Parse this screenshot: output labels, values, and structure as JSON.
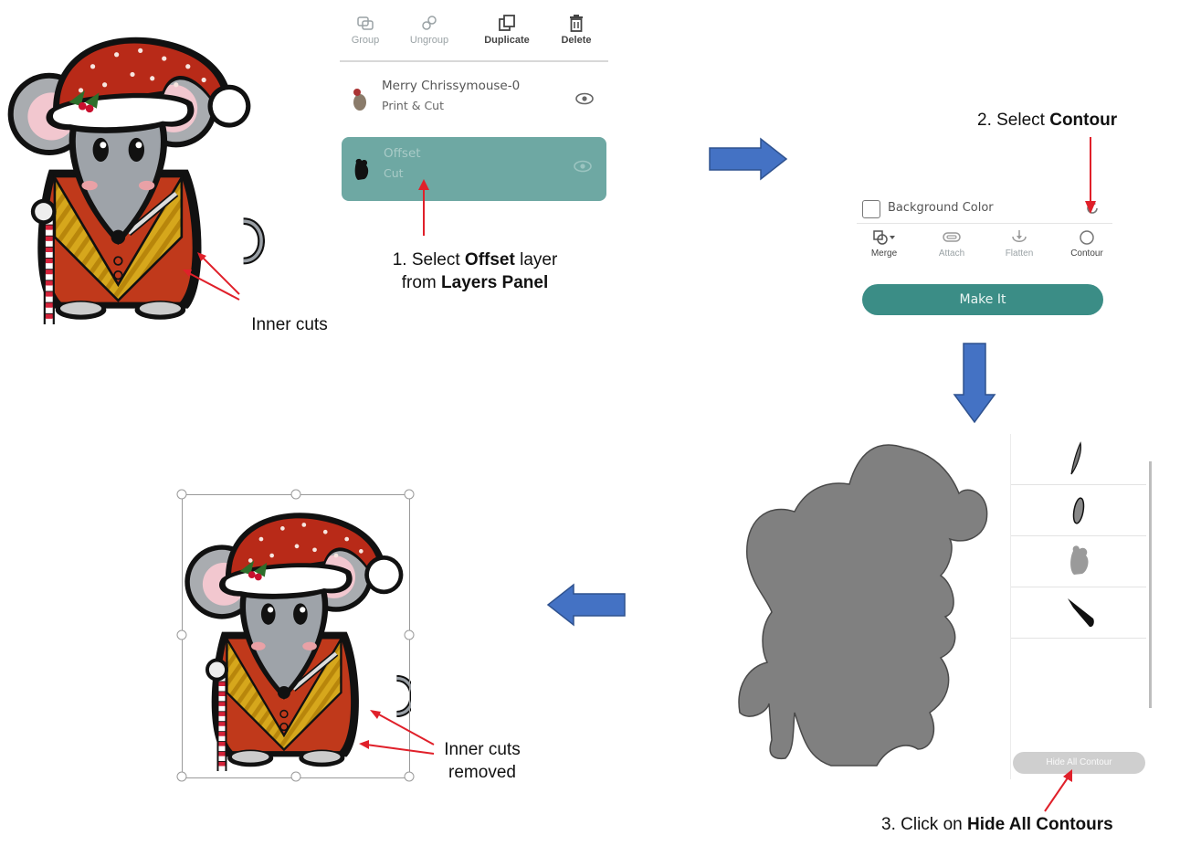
{
  "layers_panel": {
    "toolbar": [
      {
        "name": "group",
        "label": "Group",
        "icon": "group-icon"
      },
      {
        "name": "ungroup",
        "label": "Ungroup",
        "icon": "ungroup-icon"
      },
      {
        "name": "duplicate",
        "label": "Duplicate",
        "icon": "duplicate-icon"
      },
      {
        "name": "delete",
        "label": "Delete",
        "icon": "trash-icon"
      }
    ],
    "layers": [
      {
        "name": "Merry Chrissymouse-0",
        "type": "Print & Cut",
        "selected": false
      },
      {
        "name": "Offset",
        "type": "Cut",
        "selected": true
      }
    ],
    "selected_color": "#6ea8a3"
  },
  "contour_panel": {
    "background_color_label": "Background Color",
    "buttons": [
      {
        "name": "merge",
        "label": "Merge",
        "icon": "merge-icon"
      },
      {
        "name": "attach",
        "label": "Attach",
        "icon": "paperclip-icon"
      },
      {
        "name": "flatten",
        "label": "Flatten",
        "icon": "flatten-icon"
      },
      {
        "name": "contour",
        "label": "Contour",
        "icon": "contour-icon"
      }
    ],
    "make_it_label": "Make It",
    "accent_color": "#3b8d86"
  },
  "contour_list": {
    "hide_all_label": "Hide All Contour"
  },
  "annotations": {
    "inner_cuts": "Inner cuts",
    "inner_cuts_removed_line1": "Inner cuts",
    "inner_cuts_removed_line2": "removed",
    "step1": {
      "pre": "1. Select ",
      "bold1": "Offset",
      "mid": " layer",
      "line2_pre": "from ",
      "bold2": "Layers Panel"
    },
    "step2": {
      "pre": "2. Select ",
      "bold": "Contour"
    },
    "step3": {
      "pre": "3. Click on ",
      "bold": "Hide All Contours"
    }
  },
  "colors": {
    "arrow_blue": "#4472c4",
    "pointer_red": "#e0202a",
    "offset_gray": "#808080"
  }
}
